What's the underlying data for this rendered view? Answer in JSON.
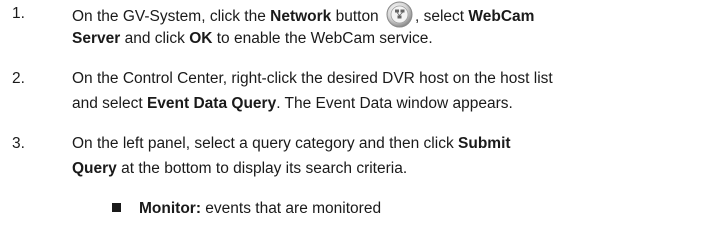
{
  "steps": [
    {
      "number": "1.",
      "line1_a": "On the GV-System, click the ",
      "line1_b": "Network",
      "line1_c": " button ",
      "line1_d": ", select ",
      "line1_e": "WebCam",
      "line2_a": "Server",
      "line2_b": " and click ",
      "line2_c": "OK",
      "line2_d": " to enable the WebCam service.",
      "icon": "network-button-icon"
    },
    {
      "number": "2.",
      "line1_a": "On the Control Center, right-click the desired DVR host on the host list",
      "line2_a": "and select ",
      "line2_b": "Event Data Query",
      "line2_c": ". The Event Data window appears."
    },
    {
      "number": "3.",
      "line1_a": "On the left panel, select a query category and then click ",
      "line1_b": "Submit",
      "line2_a": "Query",
      "line2_b": " at the bottom to display its search criteria."
    }
  ],
  "bullet": {
    "label": "Monitor:",
    "text": " events that are monitored"
  },
  "colors": {
    "text": "#1a1a1a",
    "icon_ring": "#9a9a9a"
  }
}
